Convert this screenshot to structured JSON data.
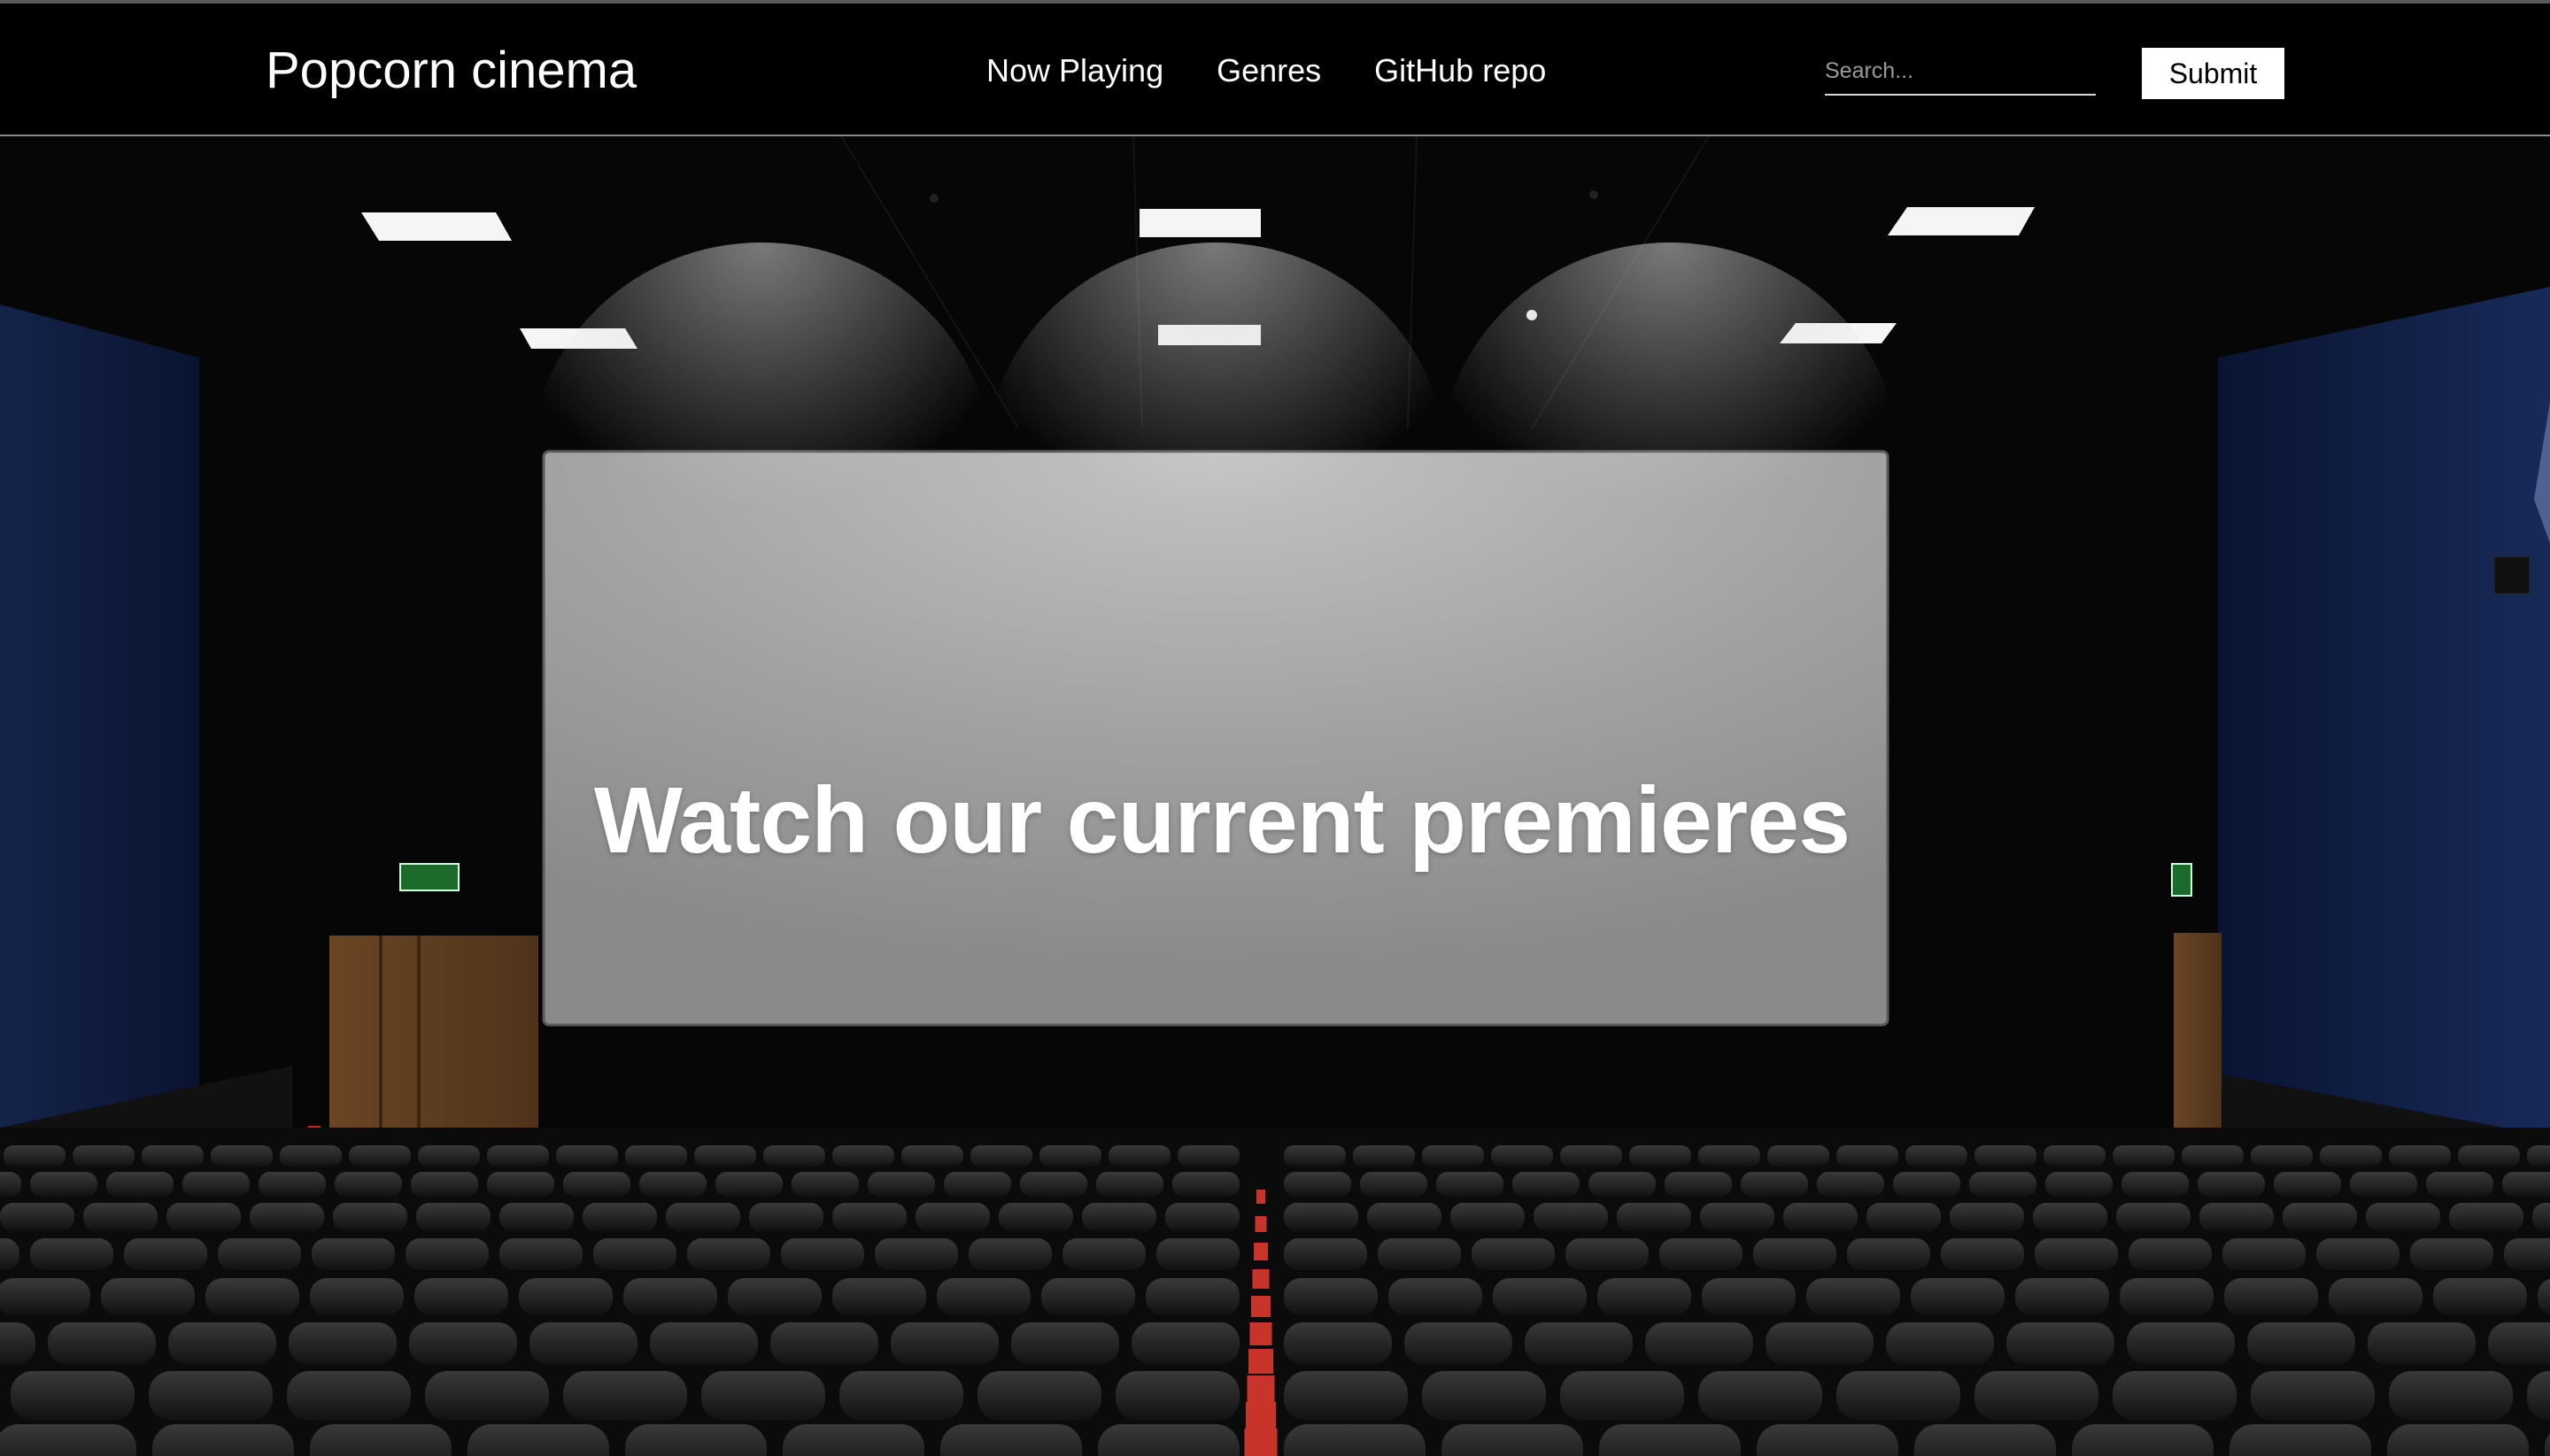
{
  "navbar": {
    "brand": "Popcorn cinema",
    "links": [
      {
        "label": "Now Playing"
      },
      {
        "label": "Genres"
      },
      {
        "label": "GitHub repo"
      }
    ],
    "search": {
      "placeholder": "Search...",
      "value": ""
    },
    "submit_label": "Submit"
  },
  "hero": {
    "headline": "Watch our current premieres",
    "background": "cinema-auditorium-photo"
  },
  "colors": {
    "navbar_bg": "#000000",
    "text": "#ffffff",
    "button_bg": "#ffffff",
    "button_text": "#000000"
  }
}
